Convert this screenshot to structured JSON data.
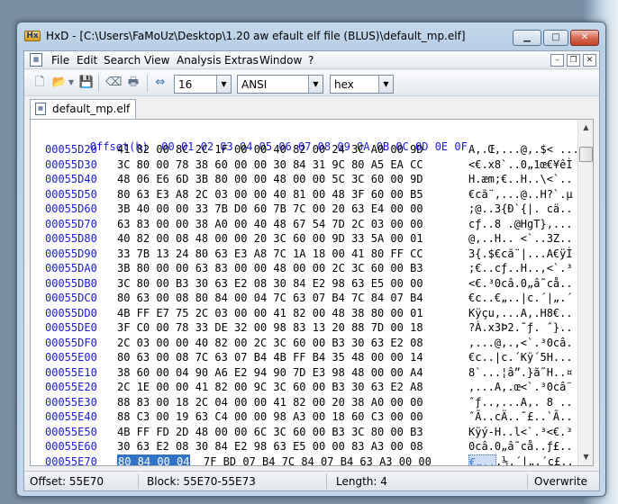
{
  "window": {
    "title": "HxD - [C:\\Users\\FaMoUz\\Desktop\\1.20 aw efault elf file (BLUS)\\default_mp.elf]",
    "icon": "hxd-app-icon",
    "icon_text": "Hx"
  },
  "menu": [
    "File",
    "Edit",
    "Search",
    "View",
    "Analysis",
    "Extras",
    "Window",
    "?"
  ],
  "toolbar": {
    "bytes_per_row": "16",
    "charset": "ANSI",
    "offset_base": "hex"
  },
  "tab": {
    "label": "default_mp.elf"
  },
  "editor": {
    "offset_header": "Offset(h)",
    "columns": [
      "00",
      "01",
      "02",
      "03",
      "04",
      "05",
      "06",
      "07",
      "08",
      "09",
      "0A",
      "0B",
      "0C",
      "0D",
      "0E",
      "0F"
    ],
    "rows": [
      {
        "offset": "00055D20",
        "hex": "41 82 00 8C 2C 1F 00 00 40 82 00 24 3C A0 00 9D",
        "ascii": "A,.Œ,...@,.$< ..."
      },
      {
        "offset": "00055D30",
        "hex": "3C 80 00 78 38 60 00 00 30 84 31 9C 80 A5 EA CC",
        "ascii": "<€.x8`..0„1œ€¥êÌ"
      },
      {
        "offset": "00055D40",
        "hex": "48 06 E6 6D 3B 80 00 00 48 00 00 5C 3C 60 00 9D",
        "ascii": "H.æm;€..H..\\<`.."
      },
      {
        "offset": "00055D50",
        "hex": "80 63 E3 A8 2C 03 00 00 40 81 00 48 3F 60 00 B5",
        "ascii": "€cã¨,...@..H?`.µ"
      },
      {
        "offset": "00055D60",
        "hex": "3B 40 00 00 33 7B D0 60 7B 7C 00 20 63 E4 00 00",
        "ascii": ";@..3{Ð`{|. cä.."
      },
      {
        "offset": "00055D70",
        "hex": "63 83 00 00 38 A0 00 40 48 67 54 7D 2C 03 00 00",
        "ascii": "cƒ..8 .@HgT},..."
      },
      {
        "offset": "00055D80",
        "hex": "40 82 00 08 48 00 00 20 3C 60 00 9D 33 5A 00 01",
        "ascii": "@,..H.. <`..3Z.."
      },
      {
        "offset": "00055D90",
        "hex": "33 7B 13 24 80 63 E3 A8 7C 1A 18 00 41 80 FF CC",
        "ascii": "3{.$€cã¨|...A€ÿÌ"
      },
      {
        "offset": "00055DA0",
        "hex": "3B 80 00 00 63 83 00 00 48 00 00 2C 3C 60 00 B3",
        "ascii": ";€..cƒ..H..,<`.³"
      },
      {
        "offset": "00055DB0",
        "hex": "3C 80 00 B3 30 63 E2 08 30 84 E2 98 63 E5 00 00",
        "ascii": "<€.³0câ.0„â˜cå.."
      },
      {
        "offset": "00055DC0",
        "hex": "80 63 00 08 80 84 00 04 7C 63 07 B4 7C 84 07 B4",
        "ascii": "€c..€„..|c.´|„.´"
      },
      {
        "offset": "00055DD0",
        "hex": "4B FF E7 75 2C 03 00 00 41 82 00 48 38 80 00 01",
        "ascii": "Kÿçu,...A‚.H8€.."
      },
      {
        "offset": "00055DE0",
        "hex": "3F C0 00 78 33 DE 32 00 98 83 13 20 88 7D 00 18",
        "ascii": "?À.x3Þ2.˜ƒ. ˆ}.."
      },
      {
        "offset": "00055DF0",
        "hex": "2C 03 00 00 40 82 00 2C 3C 60 00 B3 30 63 E2 08",
        "ascii": ",...@,.,<`.³0câ."
      },
      {
        "offset": "00055E00",
        "hex": "80 63 00 08 7C 63 07 B4 4B FF B4 35 48 00 00 14",
        "ascii": "€c..|c.´Kÿ´5H..."
      },
      {
        "offset": "00055E10",
        "hex": "38 60 00 04 90 A6 E2 94 90 7D E3 98 48 00 00 A4",
        "ascii": "8`...¦â”.}ã˜H..¤"
      },
      {
        "offset": "00055E20",
        "hex": "2C 1E 00 00 41 82 00 9C 3C 60 00 B3 30 63 E2 A8",
        "ascii": ",...A,.œ<`.³0câ¨"
      },
      {
        "offset": "00055E30",
        "hex": "88 83 00 18 2C 04 00 00 41 82 00 20 38 A0 00 00",
        "ascii": "ˆƒ..,...A‚. 8 .."
      },
      {
        "offset": "00055E40",
        "hex": "88 C3 00 19 63 C4 00 00 98 A3 00 18 60 C3 00 00",
        "ascii": "ˆÃ..cÄ..˜£..`Ã.."
      },
      {
        "offset": "00055E50",
        "hex": "4B FF FD 2D 48 00 00 6C 3C 60 00 B3 3C 80 00 B3",
        "ascii": "Kÿý-H..l<`.³<€.³"
      },
      {
        "offset": "00055E60",
        "hex": "30 63 E2 08 30 84 E2 98 63 E5 00 00 83 A3 00 08",
        "ascii": "0câ.0„â˜cå..ƒ£.."
      },
      {
        "offset": "00055E70",
        "hex": "7F BD 07 B4 7C 84 07 B4 63 A3 00 00",
        "hex_selected": "80 84 00 04",
        "ascii": ".½.´|„.´c£..",
        "ascii_selected": "€„.."
      }
    ]
  },
  "status": {
    "offset": "Offset: 55E70",
    "block": "Block: 55E70-55E73",
    "length": "Length: 4",
    "mode": "Overwrite"
  }
}
